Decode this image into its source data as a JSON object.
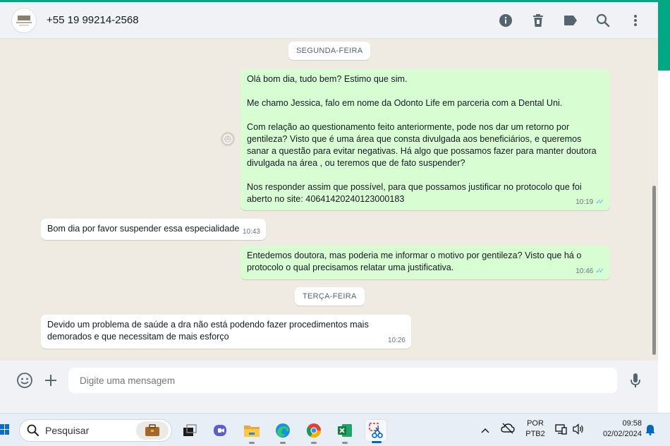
{
  "header": {
    "contact_name": "+55 19 99214-2568",
    "icons": [
      "info-icon",
      "trash-icon",
      "label-icon",
      "search-icon",
      "more-vertical-icon"
    ]
  },
  "chat": {
    "day_1": "SEGUNDA-FEIRA",
    "day_2": "TERÇA-FEIRA",
    "messages": [
      {
        "direction": "out",
        "paragraphs": [
          "Olá bom dia, tudo bem? Estimo que sim.",
          "Me chamo Jessica, falo em nome da Odonto Life em parceria com a Dental Uni.",
          "Com relação ao questionamento feito anteriormente, pode nos dar um retorno por gentileza? Visto que é uma área que consta divulgada aos beneficiários, e queremos sanar a questão para evitar negativas. Há algo que possamos fazer para manter doutora divulgada na área , ou teremos que de fato suspender?",
          "Nos responder assim que possível, para que possamos justificar no protocolo que foi aberto no site: 40641420240123000183"
        ],
        "time": "10:19",
        "status": "read"
      },
      {
        "direction": "in",
        "paragraphs": [
          "Bom dia  por favor suspender essa especialidade"
        ],
        "time": "10:43"
      },
      {
        "direction": "out",
        "paragraphs": [
          "Entedemos doutora, mas poderia me informar o motivo por gentileza? Visto que há o protocolo o qual precisamos relatar uma justificativa."
        ],
        "time": "10:46",
        "status": "read"
      },
      {
        "direction": "in",
        "paragraphs": [
          "Devido um problema  de saúde a dra não está podendo  fazer procedimentos mais demorados e que necessitam de mais esforço"
        ],
        "time": "10:26"
      }
    ]
  },
  "composer": {
    "placeholder": "Digite uma mensagem"
  },
  "taskbar": {
    "search_label": "Pesquisar",
    "language_line1": "POR",
    "language_line2": "PTB2",
    "time": "09:58",
    "date": "02/02/2024"
  },
  "colors": {
    "accent": "#00a884",
    "outgoing_bubble": "#d9fdd3",
    "incoming_bubble": "#ffffff",
    "chat_background": "#efeae2",
    "read_ticks": "#53bdeb"
  }
}
